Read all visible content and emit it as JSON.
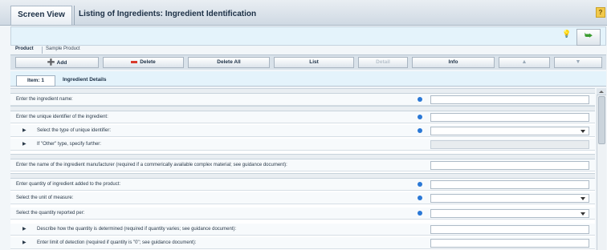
{
  "window": {
    "tab_label": "Screen View",
    "title": "Listing of Ingredients: Ingredient Identification",
    "help_label": "?"
  },
  "product": {
    "label": "Product",
    "value": "Sample Product"
  },
  "toolbar": {
    "add_label": "Add",
    "delete_label": "Delete",
    "delete_all_label": "Delete All",
    "list_label": "List",
    "detail_label": "Detail",
    "info_label": "Info"
  },
  "tabs": {
    "item_label": "Item: 1",
    "details_label": "Ingredient Details"
  },
  "form": {
    "rows": [
      {
        "label": "Enter the ingredient name:",
        "required": true,
        "control": "text"
      },
      {
        "label": "Enter the unique identifier of the ingredient:",
        "required": true,
        "control": "text"
      },
      {
        "label": "Select the type of unique identifier:",
        "required": true,
        "control": "select"
      },
      {
        "label": "If \"Other\" type, specify further:",
        "required": false,
        "control": "text-disabled"
      },
      {
        "label": "Enter the name of the ingredient manufacturer (required if a commerically available complex material; see guidance document):",
        "required": false,
        "control": "text"
      },
      {
        "label": "Enter quantity of ingredient added to the product:",
        "required": true,
        "control": "text"
      },
      {
        "label": "Select the unit of measure:",
        "required": true,
        "control": "select"
      },
      {
        "label": "Select the quantity reported per:",
        "required": true,
        "control": "select"
      },
      {
        "label": "Describe how the quantity is determined (required if quantity varies; see guidance document):",
        "required": false,
        "control": "text"
      },
      {
        "label": "Enter limit of detection (required if quantity is \"0\"; see guidance document):",
        "required": false,
        "control": "text"
      }
    ]
  },
  "colors": {
    "required_dot": "#2a78d6",
    "header_bg": "#e4f3fb",
    "add_icon": "#2f9b2a",
    "delete_icon": "#d93b2c"
  }
}
